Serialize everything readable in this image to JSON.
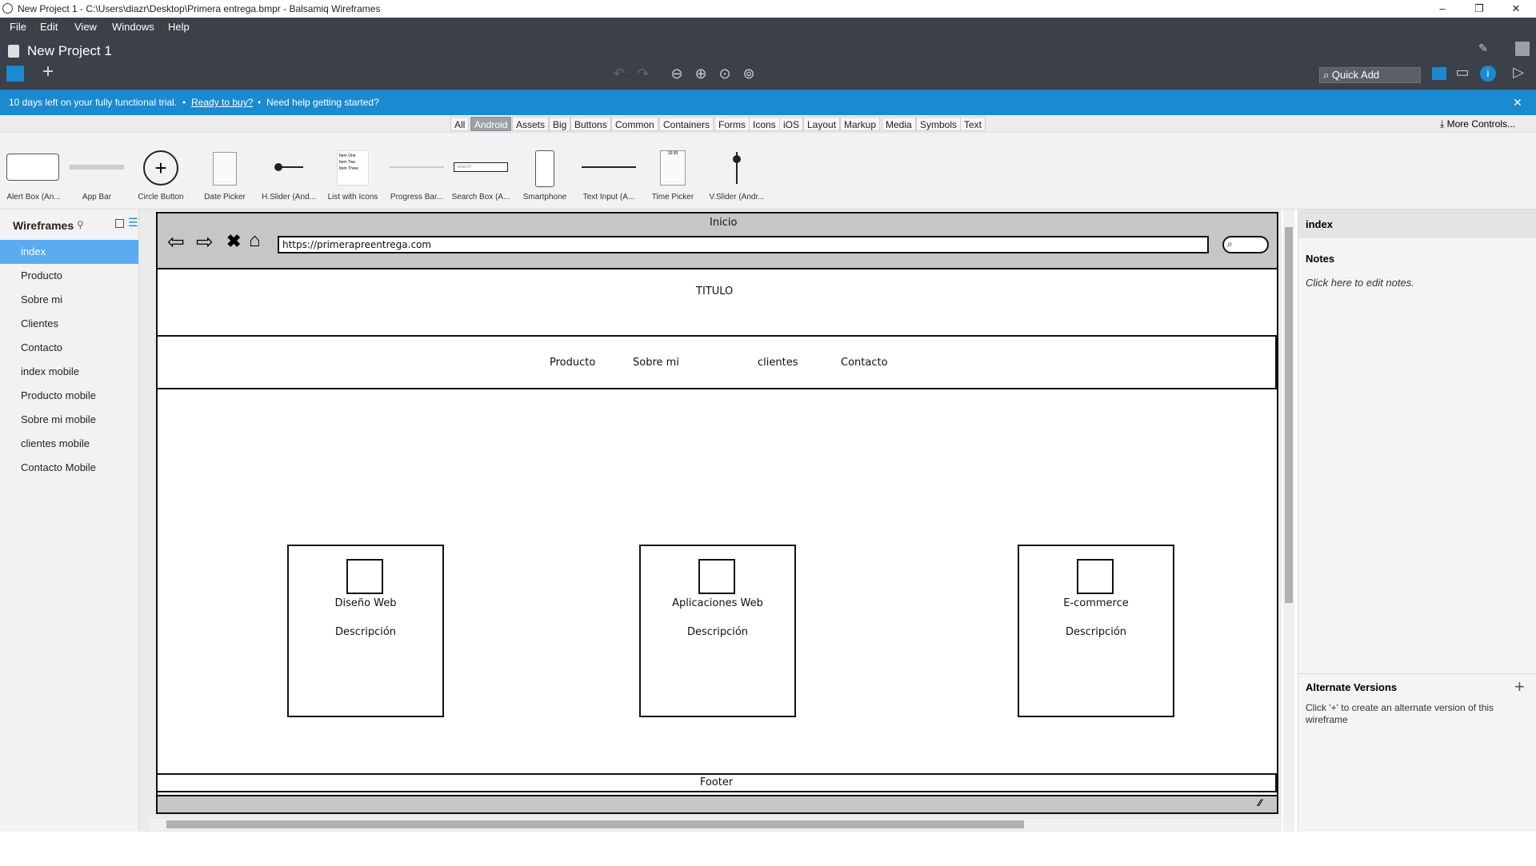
{
  "window": {
    "title": "New Project 1 - C:\\Users\\diazr\\Desktop\\Primera entrega.bmpr - Balsamiq Wireframes",
    "controls": [
      "–",
      "❐",
      "✕"
    ]
  },
  "menu": [
    "File",
    "Edit",
    "View",
    "Windows",
    "Help"
  ],
  "project_title": "New Project 1",
  "quick_add": "Quick Add",
  "trial_bar": {
    "text": "10 days left on your fully functional trial.",
    "buy_link": "Ready to buy?",
    "help_text": "Need help getting started?",
    "bullet": "•"
  },
  "categories": [
    "All",
    "Android",
    "Assets",
    "Big",
    "Buttons",
    "Common",
    "Containers",
    "Forms",
    "Icons",
    "iOS",
    "Layout",
    "Markup",
    "Media",
    "Symbols",
    "Text"
  ],
  "selected_category": "Android",
  "more_controls": "More Controls...",
  "library": [
    "Alert Box (An...",
    "App Bar",
    "Circle Button",
    "Date Picker",
    "H.Slider (And...",
    "List with Icons",
    "Progress Bar...",
    "Search Box (A...",
    "Smartphone",
    "Text Input (A...",
    "Time Picker",
    "V.Slider (Andr..."
  ],
  "library_thumb_text": {
    "list_items": [
      "Item One",
      "Item Two",
      "Item Three"
    ],
    "search": "search",
    "time": "10:30"
  },
  "wireframes": {
    "header": "Wireframes",
    "items": [
      "index",
      "Producto",
      "Sobre mi",
      "Clientes",
      "Contacto",
      "index mobile",
      "Producto mobile",
      "Sobre mi mobile",
      "clientes mobile",
      "Contacto Mobile"
    ],
    "selected": "index"
  },
  "mockup": {
    "browser_title": "Inicio",
    "url": "https://primerapreentrega.com",
    "title": "TITULO",
    "nav": [
      "Producto",
      "Sobre mi",
      "clientes",
      "Contacto"
    ],
    "cards": [
      {
        "title": "Diseño Web",
        "desc": "Descripción"
      },
      {
        "title": "Aplicaciones Web",
        "desc": "Descripción"
      },
      {
        "title": "E-commerce",
        "desc": "Descripción"
      }
    ],
    "footer": "Footer"
  },
  "right_panel": {
    "title": "index",
    "notes_header": "Notes",
    "notes_placeholder": "Click here to edit notes.",
    "alt_header": "Alternate Versions",
    "alt_text": "Click '+' to create an alternate version of this wireframe"
  },
  "colors": {
    "header_bg": "#3c4048",
    "info_bar": "#1a8ad1",
    "selected_page": "#5aacf0"
  }
}
